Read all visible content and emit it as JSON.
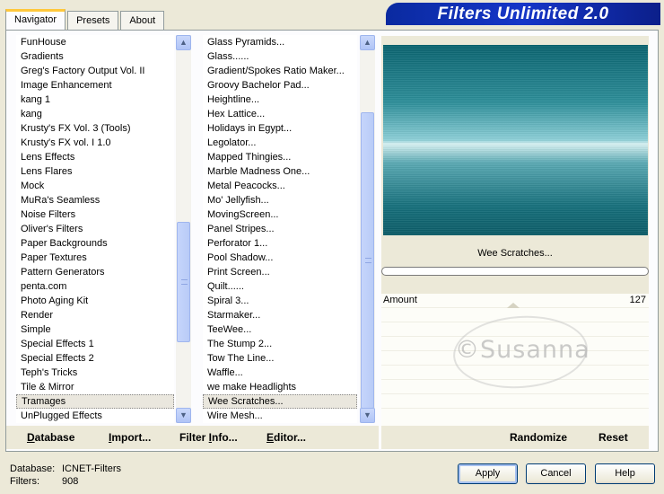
{
  "tabs": [
    "Navigator",
    "Presets",
    "About"
  ],
  "app_title": "Filters Unlimited 2.0",
  "categories": [
    "FunHouse",
    "Gradients",
    "Greg's Factory Output Vol. II",
    "Image Enhancement",
    "kang 1",
    "kang",
    "Krusty's FX Vol. 3 (Tools)",
    "Krusty's FX vol. I 1.0",
    "Lens Effects",
    "Lens Flares",
    "Mock",
    "MuRa's Seamless",
    "Noise Filters",
    "Oliver's Filters",
    "Paper Backgrounds",
    "Paper Textures",
    "Pattern Generators",
    "penta.com",
    "Photo Aging Kit",
    "Render",
    "Simple",
    "Special Effects 1",
    "Special Effects 2",
    "Teph's Tricks",
    "Tile & Mirror",
    "Tramages",
    "UnPlugged Effects"
  ],
  "selected_category": "Tramages",
  "filters": [
    "Glass Pyramids...",
    "Glass......",
    "Gradient/Spokes Ratio Maker...",
    "Groovy Bachelor Pad...",
    "Heightline...",
    "Hex Lattice...",
    "Holidays in Egypt...",
    "Legolator...",
    "Mapped Thingies...",
    "Marble Madness One...",
    "Metal Peacocks...",
    "Mo' Jellyfish...",
    "MovingScreen...",
    "Panel Stripes...",
    "Perforator 1...",
    "Pool Shadow...",
    "Print Screen...",
    "Quilt......",
    "Spiral 3...",
    "Starmaker...",
    "TeeWee...",
    "The Stump 2...",
    "Tow The Line...",
    "Waffle...",
    "we make Headlights",
    "Wee Scratches...",
    "Wire Mesh..."
  ],
  "selected_filter": "Wee Scratches...",
  "preview": {
    "filter_name": "Wee Scratches..."
  },
  "params": {
    "label": "Amount",
    "value": "127"
  },
  "watermark": "©Susanna",
  "bottom_left_buttons": {
    "database": {
      "underlined": "D",
      "rest": "atabase"
    },
    "import": {
      "underlined": "I",
      "rest": "mport..."
    },
    "filter_info": {
      "pre": "Filter ",
      "underlined": "I",
      "rest": "nfo..."
    },
    "editor": {
      "underlined": "E",
      "rest": "ditor..."
    }
  },
  "bottom_right_buttons": {
    "randomize": "Randomize",
    "reset": "Reset"
  },
  "status": {
    "database_key": "Database:",
    "database_val": "ICNET-Filters",
    "filters_key": "Filters:",
    "filters_val": "908"
  },
  "dialog_buttons": {
    "apply": "Apply",
    "cancel": "Cancel",
    "help": "Help"
  }
}
